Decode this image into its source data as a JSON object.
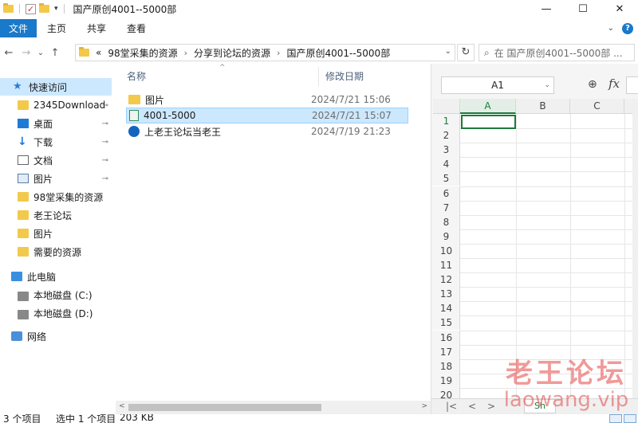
{
  "window": {
    "title": "国产原创4001--5000部",
    "minimize": "—",
    "maximize": "☐",
    "close": "✕"
  },
  "ribbon": {
    "tabs": [
      "文件",
      "主页",
      "共享",
      "查看"
    ],
    "expand_glyph": "⌄",
    "help_glyph": "?"
  },
  "address": {
    "back": "←",
    "forward": "→",
    "recent": "⌄",
    "up": "↑",
    "overflow": "«",
    "breadcrumb": [
      "98堂采集的资源",
      "分享到论坛的资源",
      "国产原创4001--5000部"
    ],
    "separator": "›",
    "dropdown": "⌄",
    "refresh": "↻",
    "search_placeholder": "在 国产原创4001--5000部 ..."
  },
  "nav": {
    "pin_glyph": "📌",
    "items": [
      {
        "label": "快速访问",
        "icon": "star-icon",
        "pinned": false,
        "selected": true
      },
      {
        "label": "2345Download",
        "icon": "folder-icon",
        "pinned": true,
        "selected": false
      },
      {
        "label": "桌面",
        "icon": "desktop-icon",
        "pinned": true,
        "selected": false
      },
      {
        "label": "下载",
        "icon": "download-icon",
        "pinned": true,
        "selected": false
      },
      {
        "label": "文档",
        "icon": "document-icon",
        "pinned": true,
        "selected": false
      },
      {
        "label": "图片",
        "icon": "pictures-icon",
        "pinned": true,
        "selected": false
      },
      {
        "label": "98堂采集的资源",
        "icon": "folder-icon",
        "pinned": false,
        "selected": false
      },
      {
        "label": "老王论坛",
        "icon": "folder-icon",
        "pinned": false,
        "selected": false
      },
      {
        "label": "图片",
        "icon": "folder-icon",
        "pinned": false,
        "selected": false
      },
      {
        "label": "需要的资源",
        "icon": "folder-icon",
        "pinned": false,
        "selected": false
      },
      {
        "label": "此电脑",
        "icon": "computer-icon",
        "pinned": false,
        "selected": false
      },
      {
        "label": "本地磁盘 (C:)",
        "icon": "drive-icon",
        "pinned": false,
        "selected": false
      },
      {
        "label": "本地磁盘 (D:)",
        "icon": "drive-icon",
        "pinned": false,
        "selected": false
      },
      {
        "label": "网络",
        "icon": "network-icon",
        "pinned": false,
        "selected": false
      }
    ]
  },
  "filelist": {
    "columns": {
      "name": "名称",
      "modified": "修改日期"
    },
    "sort_caret": "^",
    "rows": [
      {
        "name": "图片",
        "date": "2024/7/21 15:06",
        "icon": "folder-icon",
        "selected": false
      },
      {
        "name": "4001-5000",
        "date": "2024/7/21 15:07",
        "icon": "spreadsheet-icon",
        "selected": true
      },
      {
        "name": "上老王论坛当老王",
        "date": "2024/7/19 21:23",
        "icon": "app-icon",
        "selected": false
      }
    ]
  },
  "preview": {
    "cell_ref": "A1",
    "namebox_dropdown": "⌄",
    "zoom_glyph": "⊕",
    "fx": "fx",
    "columns": [
      "A",
      "B",
      "C"
    ],
    "rows": [
      "1",
      "2",
      "3",
      "4",
      "5",
      "6",
      "7",
      "8",
      "9",
      "10",
      "11",
      "12",
      "13",
      "14",
      "15",
      "16",
      "17",
      "18",
      "19",
      "20"
    ],
    "sheet_tab": "Sh",
    "sheet_nav": [
      "|<",
      "<",
      ">"
    ]
  },
  "scrollbar": {
    "left": "<",
    "right": ">"
  },
  "status": {
    "item_count": "3 个项目",
    "selection": "选中 1 个项目",
    "size": "203 KB"
  },
  "watermark": {
    "text": "老王论坛",
    "url": "laowang.vip"
  }
}
